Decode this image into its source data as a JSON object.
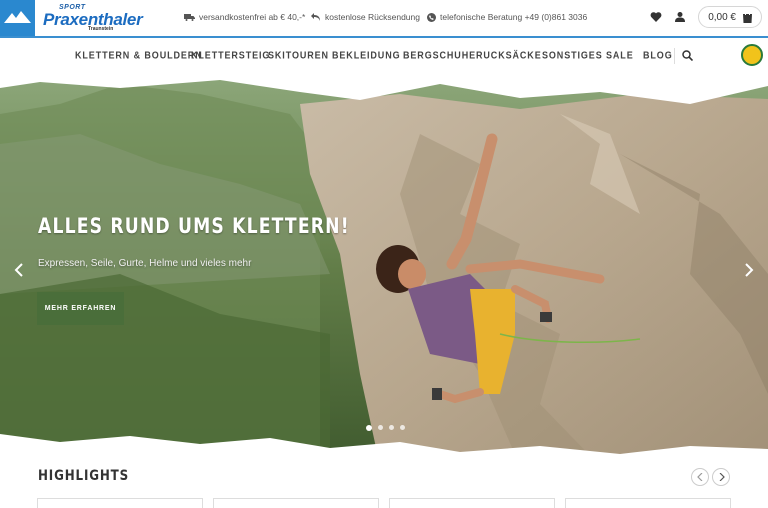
{
  "brand": {
    "prefix": "SPORT",
    "name": "Praxenthaler",
    "city": "Traunstein"
  },
  "usps": [
    {
      "icon": "truck-icon",
      "text": "versandkostenfrei ab € 40,-*"
    },
    {
      "icon": "return-icon",
      "text": "kostenlose Rücksendung"
    },
    {
      "icon": "phone-icon",
      "text": "telefonische Beratung +49 (0)861 3036"
    }
  ],
  "cart": {
    "total": "0,00 €"
  },
  "nav": [
    "KLETTERN & BOULDERN",
    "KLETTERSTEIG",
    "SKITOUREN",
    "BEKLEIDUNG",
    "BERGSCHUHE",
    "RUCKSÄCKE",
    "SONSTIGES",
    "SALE",
    "BLOG"
  ],
  "hero": {
    "title": "ALLES RUND UMS KLETTERN!",
    "subtitle": "Expressen, Seile, Gurte, Helme und vieles mehr",
    "cta": "MEHR ERFAHREN",
    "slides_total": 4,
    "active_slide": 1
  },
  "highlights": {
    "title": "HIGHLIGHTS"
  },
  "colors": {
    "brand_blue": "#2a88cf",
    "cta_green": "#4a6e3a",
    "accent_line": "#3a8fd0"
  }
}
